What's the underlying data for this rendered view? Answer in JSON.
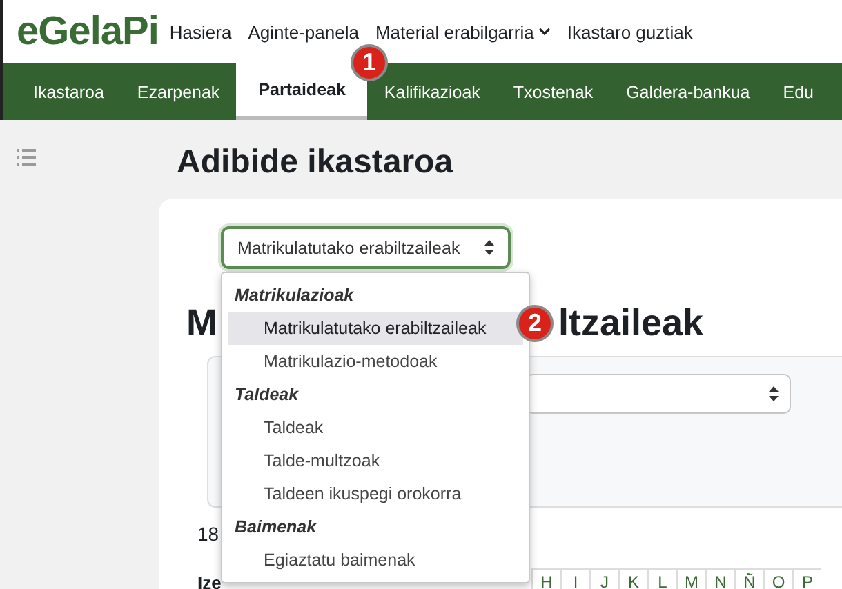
{
  "header": {
    "logo": "eGelaPi",
    "links": [
      {
        "label": "Hasiera",
        "dropdown": false
      },
      {
        "label": "Aginte-panela",
        "dropdown": false
      },
      {
        "label": "Material erabilgarria",
        "dropdown": true
      },
      {
        "label": "Ikastaro guztiak",
        "dropdown": false
      }
    ]
  },
  "nav": {
    "tabs": [
      {
        "label": "Ikastaroa",
        "selected": false
      },
      {
        "label": "Ezarpenak",
        "selected": false
      },
      {
        "label": "Partaideak",
        "selected": true
      },
      {
        "label": "Kalifikazioak",
        "selected": false
      },
      {
        "label": "Txostenak",
        "selected": false
      },
      {
        "label": "Galdera-bankua",
        "selected": false
      },
      {
        "label": "Edu",
        "selected": false
      }
    ]
  },
  "callouts": [
    "1",
    "2"
  ],
  "page_title": "Adibide ikastaroa",
  "page_select": {
    "value": "Matrikulatutako erabiltzaileak"
  },
  "menu": [
    {
      "label": "Matrikulazioak",
      "items": [
        {
          "label": "Matrikulatutako erabiltzaileak",
          "selected": true
        },
        {
          "label": "Matrikulazio-metodoak",
          "selected": false
        }
      ]
    },
    {
      "label": "Taldeak",
      "items": [
        {
          "label": "Taldeak",
          "selected": false
        },
        {
          "label": "Talde-multzoak",
          "selected": false
        },
        {
          "label": "Taldeen ikuspegi orokorra",
          "selected": false
        }
      ]
    },
    {
      "label": "Baimenak",
      "items": [
        {
          "label": "Egiaztatu baimenak",
          "selected": false
        }
      ]
    }
  ],
  "heading_parts": [
    "M",
    "ltzaileak"
  ],
  "participant_count": "18",
  "name_label": "Ize",
  "letters": [
    "H",
    "I",
    "J",
    "K",
    "L",
    "M",
    "N",
    "Ñ",
    "O",
    "P"
  ]
}
